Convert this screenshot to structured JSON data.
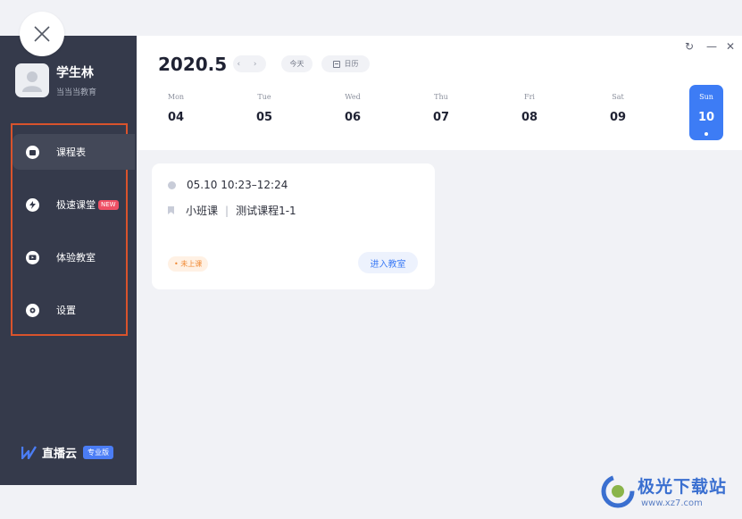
{
  "window": {
    "close_icon": "close-icon",
    "refresh_glyph": "↻",
    "minimize_glyph": "—",
    "close_glyph": "✕"
  },
  "profile": {
    "name": "学生林",
    "org": "当当当教育"
  },
  "nav": {
    "items": [
      {
        "label": "课程表",
        "icon": "schedule-icon",
        "active": true
      },
      {
        "label": "极速课堂",
        "icon": "lightning-icon",
        "badge": "NEW"
      },
      {
        "label": "体验教室",
        "icon": "classroom-icon"
      },
      {
        "label": "设置",
        "icon": "gear-icon"
      }
    ]
  },
  "brand": {
    "name": "直播云",
    "edition": "专业版",
    "accent": "#4b7df5"
  },
  "header": {
    "month": "2020.5",
    "prev_next": "‹ ›",
    "today_label": "今天",
    "calendar_label": "日历"
  },
  "week": [
    {
      "name": "Mon",
      "num": "04"
    },
    {
      "name": "Tue",
      "num": "05"
    },
    {
      "name": "Wed",
      "num": "06"
    },
    {
      "name": "Thu",
      "num": "07"
    },
    {
      "name": "Fri",
      "num": "08"
    },
    {
      "name": "Sat",
      "num": "09"
    },
    {
      "name": "Sun",
      "num": "10",
      "selected": true
    }
  ],
  "course": {
    "date": "05.10",
    "time": "10:23–12:24",
    "type": "小班课",
    "separator": "|",
    "title": "测试课程1-1",
    "status": "• 未上课",
    "enter_label": "进入教室"
  },
  "watermark": {
    "text": "极光下载站",
    "url": "www.xz7.com"
  },
  "colors": {
    "sidebar": "#353a4b",
    "accent": "#3d7cf5",
    "status": "#f08a35",
    "highlight_frame": "#d9532c"
  }
}
